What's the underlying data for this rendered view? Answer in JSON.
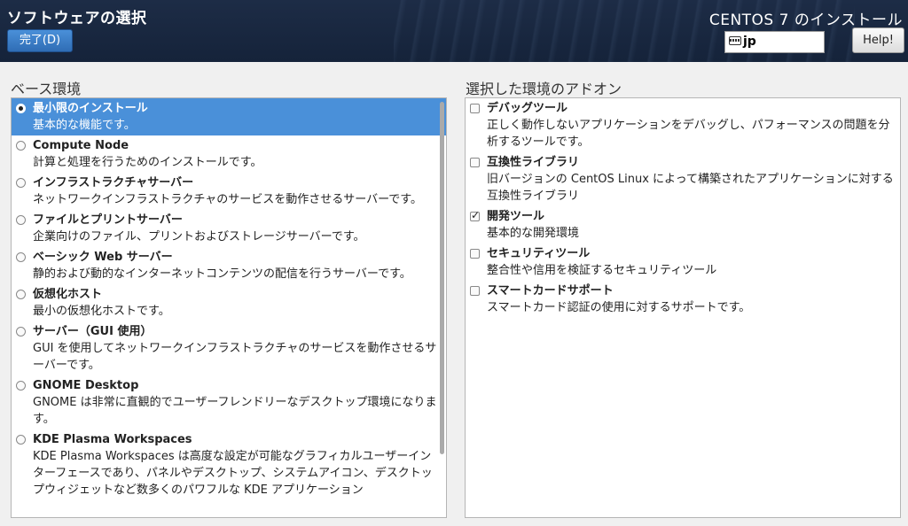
{
  "header": {
    "title": "ソフトウェアの選択",
    "done_label": "完了(D)",
    "install_title": "CENTOS 7 のインストール",
    "keyboard_value": "jp",
    "help_label": "Help!"
  },
  "base": {
    "label": "ベース環境",
    "items": [
      {
        "name": "最小限のインストール",
        "desc": "基本的な機能です。",
        "selected": true
      },
      {
        "name": "Compute Node",
        "desc": "計算と処理を行うためのインストールです。",
        "selected": false
      },
      {
        "name": "インフラストラクチャサーバー",
        "desc": "ネットワークインフラストラクチャのサービスを動作させるサーバーです。",
        "selected": false
      },
      {
        "name": "ファイルとプリントサーバー",
        "desc": "企業向けのファイル、プリントおよびストレージサーバーです。",
        "selected": false
      },
      {
        "name": "ベーシック Web サーバー",
        "desc": "静的および動的なインターネットコンテンツの配信を行うサーバーです。",
        "selected": false
      },
      {
        "name": "仮想化ホスト",
        "desc": "最小の仮想化ホストです。",
        "selected": false
      },
      {
        "name": "サーバー（GUI 使用）",
        "desc": "GUI を使用してネットワークインフラストラクチャのサービスを動作させるサーバーです。",
        "selected": false
      },
      {
        "name": "GNOME Desktop",
        "desc": "GNOME は非常に直観的でユーザーフレンドリーなデスクトップ環境になります。",
        "selected": false
      },
      {
        "name": "KDE Plasma Workspaces",
        "desc": "KDE Plasma Workspaces は高度な設定が可能なグラフィカルユーザーインターフェースであり、パネルやデスクトップ、システムアイコン、デスクトップウィジェットなど数多くのパワフルな KDE アプリケーション",
        "selected": false
      }
    ]
  },
  "addons": {
    "label": "選択した環境のアドオン",
    "items": [
      {
        "name": "デバッグツール",
        "desc": "正しく動作しないアプリケーションをデバッグし、パフォーマンスの問題を分析するツールです。",
        "checked": false
      },
      {
        "name": "互換性ライブラリ",
        "desc": "旧バージョンの CentOS Linux によって構築されたアプリケーションに対する互換性ライブラリ",
        "checked": false
      },
      {
        "name": "開発ツール",
        "desc": "基本的な開発環境",
        "checked": true
      },
      {
        "name": "セキュリティツール",
        "desc": "整合性や信用を検証するセキュリティツール",
        "checked": false
      },
      {
        "name": "スマートカードサポート",
        "desc": "スマートカード認証の使用に対するサポートです。",
        "checked": false
      }
    ]
  }
}
